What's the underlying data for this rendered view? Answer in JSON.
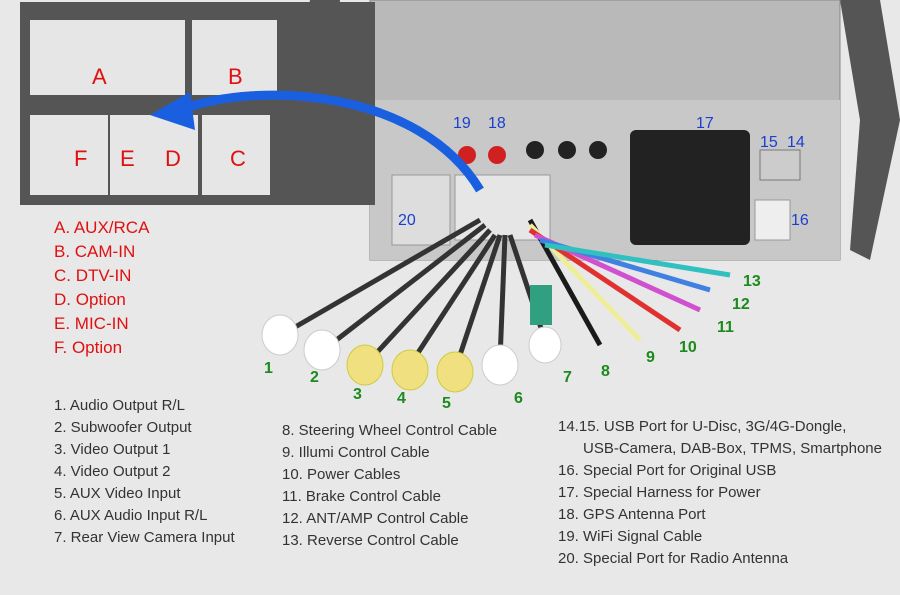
{
  "connector_inset": {
    "letters": [
      "A",
      "B",
      "F",
      "E",
      "D",
      "C"
    ]
  },
  "connector_legend": [
    "A. AUX/RCA",
    "B. CAM-IN",
    "C. DTV-IN",
    "D. Option",
    "E. MIC-IN",
    "F. Option"
  ],
  "device_labels": [
    "19",
    "18",
    "17",
    "15",
    "14",
    "20",
    "16"
  ],
  "cable_labels": [
    "1",
    "2",
    "3",
    "4",
    "5",
    "6",
    "7",
    "8",
    "9",
    "10",
    "11",
    "12",
    "13"
  ],
  "list_left": [
    "1. Audio Output R/L",
    "2. Subwoofer Output",
    "3. Video Output 1",
    "4. Video Output 2",
    "5. AUX Video Input",
    "6. AUX Audio Input R/L",
    "7. Rear View Camera Input"
  ],
  "list_middle": [
    "8. Steering Wheel Control Cable",
    "9. Illumi Control Cable",
    "10. Power Cables",
    "11. Brake Control Cable",
    "12. ANT/AMP Control Cable",
    "13. Reverse Control Cable"
  ],
  "list_right": [
    "14.15. USB Port for U-Disc, 3G/4G-Dongle,",
    "USB-Camera, DAB-Box, TPMS, Smartphone",
    "16. Special Port for Original USB",
    "17. Special Harness for Power",
    "18. GPS Antenna Port",
    "19. WiFi Signal Cable",
    "20. Special Port for Radio Antenna"
  ],
  "colors": {
    "background": "#e8e8e8",
    "legend_red": "#e01010",
    "port_blue": "#1a3fd0",
    "cable_green": "#1d8a1d",
    "arrow_blue": "#1a5fe0"
  }
}
